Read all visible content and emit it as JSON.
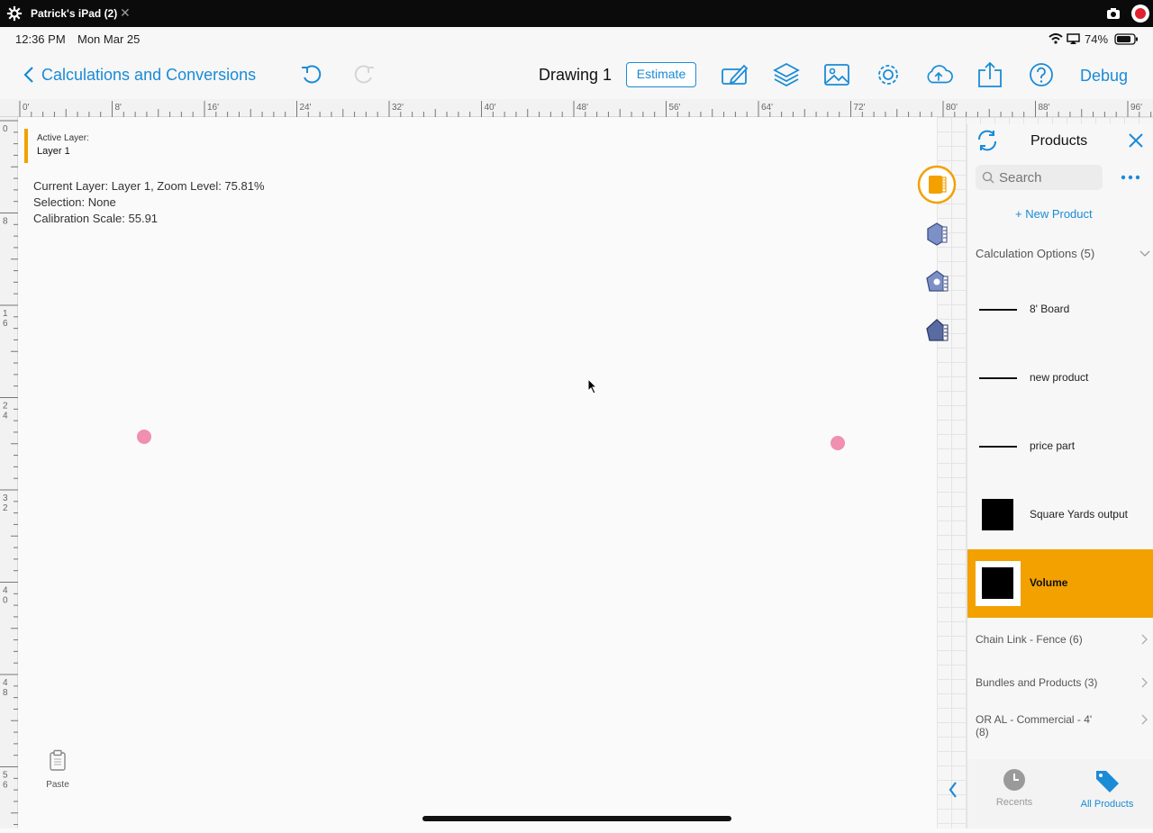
{
  "titlebar": {
    "title": "Patrick's iPad (2)",
    "close": "✕"
  },
  "statusbar": {
    "time": "12:36 PM",
    "date": "Mon Mar 25",
    "battery": "74%"
  },
  "nav": {
    "back_label": "Calculations and Conversions",
    "title": "Drawing 1",
    "estimate_label": "Estimate",
    "debug_label": "Debug",
    "icons": [
      "undo-icon",
      "redo-icon",
      "edit-icon",
      "layers-icon",
      "image-icon",
      "gear-icon",
      "cloud-upload-icon",
      "share-icon",
      "help-icon"
    ]
  },
  "ruler": {
    "top_labels": [
      "0'",
      "8'",
      "16'",
      "24'",
      "32'",
      "40'",
      "48'",
      "56'",
      "64'",
      "72'",
      "80'",
      "88'",
      "96'"
    ],
    "left_labels": [
      "0",
      "8",
      "16",
      "24",
      "32",
      "40",
      "48",
      "56"
    ]
  },
  "active_layer": {
    "label": "Active Layer:",
    "value": "Layer 1"
  },
  "info": {
    "line1": "Current Layer: Layer 1, Zoom Level: 75.81%",
    "line2": "Selection: None",
    "line3": "Calibration Scale: 55.91"
  },
  "paste_label": "Paste",
  "panel": {
    "title": "Products",
    "search_placeholder": "Search",
    "new_product": "+ New Product",
    "category": "Calculation Options (5)",
    "products": [
      {
        "name": "8' Board",
        "icon": "line"
      },
      {
        "name": "new product",
        "icon": "line"
      },
      {
        "name": "price part",
        "icon": "line"
      },
      {
        "name": "Square Yards output",
        "icon": "square"
      },
      {
        "name": "Volume",
        "icon": "square",
        "selected": true
      }
    ],
    "groups": [
      "Chain Link - Fence (6)",
      "Bundles and Products (3)",
      "OR AL - Commercial - 4' (8)"
    ],
    "tabs": {
      "recents": "Recents",
      "all_products": "All Products"
    }
  },
  "colors": {
    "accent": "#1a8bd6",
    "selection": "#f2a100",
    "point": "#f08fb0"
  }
}
